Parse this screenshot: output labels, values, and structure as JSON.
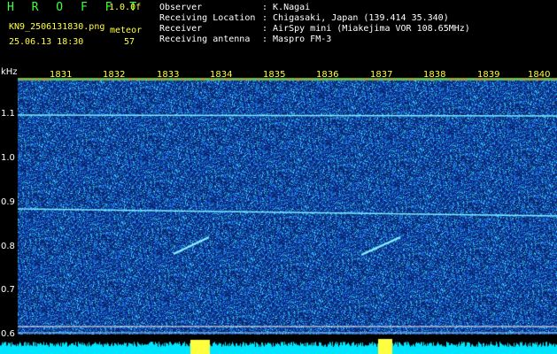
{
  "app": {
    "brand": "H R O F F T",
    "version": "1.0.0f",
    "filename": "KN9_2506131830.png",
    "datetime": "25.06.13 18:30",
    "meteor_label": "meteor",
    "meteor_count": "57"
  },
  "info": {
    "observer_label": "Observer",
    "observer_value": ": K.Nagai",
    "location_label": "Receiving Location",
    "location_value": ": Chigasaki, Japan (139.414 35.340)",
    "receiver_label": "Receiver",
    "receiver_value": ": AirSpy mini (Miakejima VOR 108.65MHz)",
    "antenna_label": "Receiving antenna",
    "antenna_value": ": Maspro FM-3"
  },
  "axis": {
    "unit": "kHz",
    "y_ticks": [
      "1.1",
      "1.0",
      "0.9",
      "0.8",
      "0.7",
      "0.6"
    ],
    "time_ticks": [
      "1831",
      "1832",
      "1833",
      "1834",
      "1835",
      "1836",
      "1837",
      "1838",
      "1839",
      "1840"
    ]
  },
  "colors": {
    "background": "#000000",
    "noise_dark": "#0a1a6a",
    "noise_light": "#3a7cff",
    "signal": "#7cf0ff",
    "header_text": "#ffffff",
    "accent_yellow": "#ffff40",
    "accent_green": "#40ff40",
    "bottom_band": "#00e5ff"
  }
}
